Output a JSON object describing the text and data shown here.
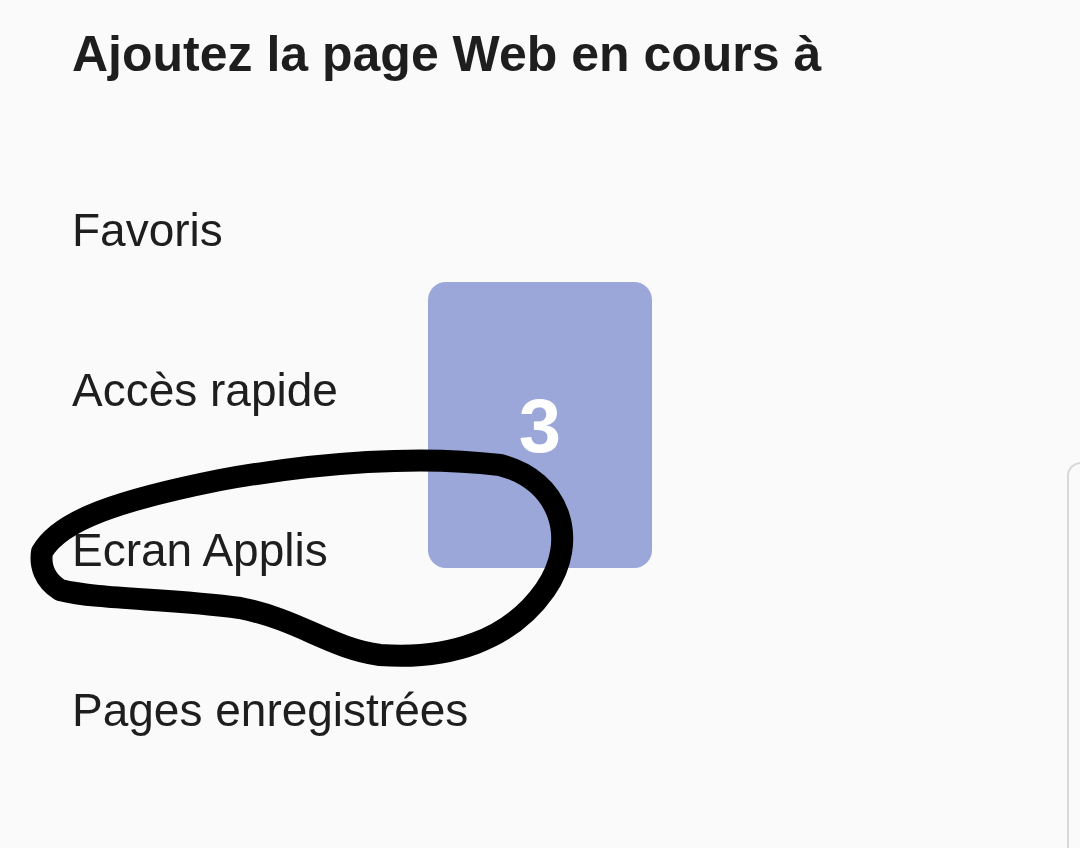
{
  "dialog": {
    "title": "Ajoutez la page Web en cours à"
  },
  "options": [
    {
      "label": "Favoris"
    },
    {
      "label": "Accès rapide"
    },
    {
      "label": "Ecran Applis"
    },
    {
      "label": "Pages enregistrées"
    }
  ],
  "annotation": {
    "badge": "3"
  }
}
